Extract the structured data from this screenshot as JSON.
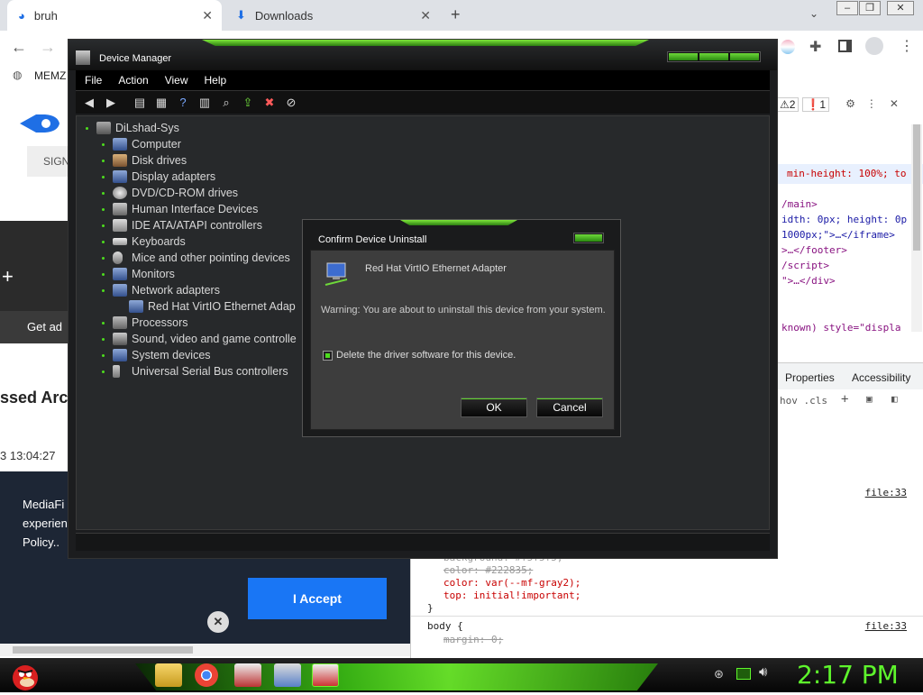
{
  "browser": {
    "tabs": [
      {
        "title": "bruh"
      },
      {
        "title": "Downloads"
      }
    ],
    "bookmark": "MEMZ",
    "devtools_badges": {
      "warnings": "2",
      "errors": "1"
    },
    "devtools_code": [
      "min-height: 100%; to",
      "/main>",
      "idth: 0px; height: 0p",
      "1000px;\">…</iframe>",
      ">…</footer>",
      "/script>",
      "\">…</div>",
      "known) style=\"displa"
    ],
    "devtools_tabs": [
      "Properties",
      "Accessibility"
    ],
    "devtools_filter": "hov .cls",
    "file_ref": "file:33",
    "css_lines": [
      "background: #f5f5f5;",
      "color: #222835;",
      "color: var(--mf-gray2);",
      "top: initial!important;",
      "}",
      "body {",
      "margin: 0;"
    ],
    "page": {
      "signin": "SIGN",
      "getad": "Get ad",
      "heading": "ssed Arc",
      "time": "3 13:04:27",
      "cookie_lines": [
        "MediaFi",
        "experien",
        "Policy.."
      ],
      "accept": "I Accept"
    }
  },
  "device_manager": {
    "title": "Device Manager",
    "menu": [
      "File",
      "Action",
      "View",
      "Help"
    ],
    "tree": [
      {
        "label": "DiLshad-Sys",
        "level": 0
      },
      {
        "label": "Computer",
        "level": 1
      },
      {
        "label": "Disk drives",
        "level": 1
      },
      {
        "label": "Display adapters",
        "level": 1
      },
      {
        "label": "DVD/CD-ROM drives",
        "level": 1
      },
      {
        "label": "Human Interface Devices",
        "level": 1
      },
      {
        "label": "IDE ATA/ATAPI controllers",
        "level": 1
      },
      {
        "label": "Keyboards",
        "level": 1
      },
      {
        "label": "Mice and other pointing devices",
        "level": 1
      },
      {
        "label": "Monitors",
        "level": 1
      },
      {
        "label": "Network adapters",
        "level": 1
      },
      {
        "label": "Red Hat VirtIO Ethernet Adap",
        "level": 2
      },
      {
        "label": "Processors",
        "level": 1
      },
      {
        "label": "Sound, video and game controlle",
        "level": 1
      },
      {
        "label": "System devices",
        "level": 1
      },
      {
        "label": "Universal Serial Bus controllers",
        "level": 1
      }
    ]
  },
  "dialog": {
    "title": "Confirm Device Uninstall",
    "device": "Red Hat VirtIO Ethernet Adapter",
    "warning": "Warning: You are about to uninstall this device from your system.",
    "checkbox_label": "Delete the driver software for this device.",
    "checkbox_checked": false,
    "ok": "OK",
    "cancel": "Cancel"
  },
  "taskbar": {
    "clock": "2:17 PM",
    "accent": "#5ef52c"
  }
}
